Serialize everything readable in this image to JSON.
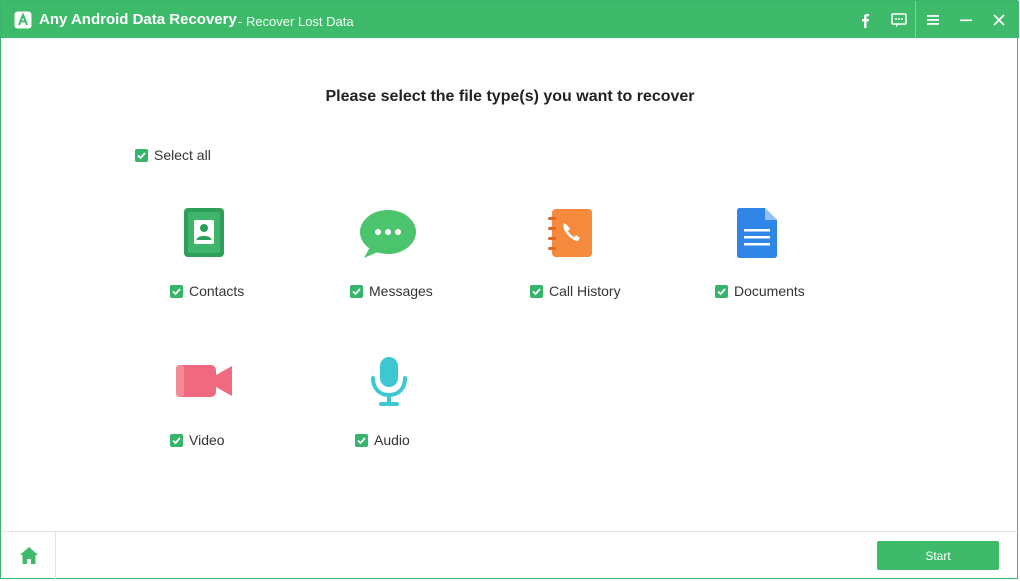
{
  "window": {
    "app_name": "Any Android Data Recovery",
    "subtitle": "- Recover Lost Data"
  },
  "titlebar_buttons": [
    "facebook-icon",
    "feedback-icon",
    "menu-icon",
    "minimize-icon",
    "close-icon"
  ],
  "main": {
    "heading": "Please select the file type(s) you want to recover",
    "select_all": {
      "label": "Select all",
      "checked": true
    },
    "file_types": [
      {
        "label": "Contacts",
        "icon": "contacts-icon",
        "checked": true
      },
      {
        "label": "Messages",
        "icon": "messages-icon",
        "checked": true
      },
      {
        "label": "Call History",
        "icon": "call-history-icon",
        "checked": true
      },
      {
        "label": "Documents",
        "icon": "documents-icon",
        "checked": true
      },
      {
        "label": "Video",
        "icon": "video-icon",
        "checked": true
      },
      {
        "label": "Audio",
        "icon": "audio-icon",
        "checked": true
      }
    ]
  },
  "footer": {
    "home_icon": "home-icon",
    "start_label": "Start"
  },
  "colors": {
    "accent": "#3dbb6a",
    "checkbox": "#36b56a",
    "contacts": "#2e9e5b",
    "messages": "#4cc46e",
    "call_history": "#f58a3c",
    "documents": "#2f86e6",
    "video": "#f06a7f",
    "audio": "#3cc8d0"
  }
}
